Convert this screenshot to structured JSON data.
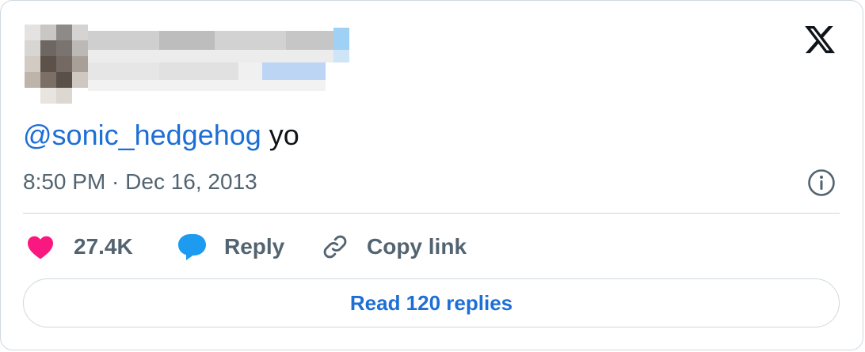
{
  "tweet": {
    "mention": "@sonic_hedgehog",
    "text": " yo",
    "timestamp": "8:50 PM · Dec 16, 2013"
  },
  "actions": {
    "like_count": "27.4K",
    "reply_label": "Reply",
    "copy_link_label": "Copy link"
  },
  "read_replies_label": "Read 120 replies",
  "colors": {
    "accent": "#1d6fd6",
    "heart": "#f91880",
    "reply_bubble": "#1d9bf0",
    "muted_text": "#536471",
    "border": "#cfd9de"
  },
  "icons": {
    "brand": "x-logo-icon",
    "like": "heart-icon",
    "reply": "speech-bubble-icon",
    "copy": "link-icon",
    "info": "info-icon"
  }
}
